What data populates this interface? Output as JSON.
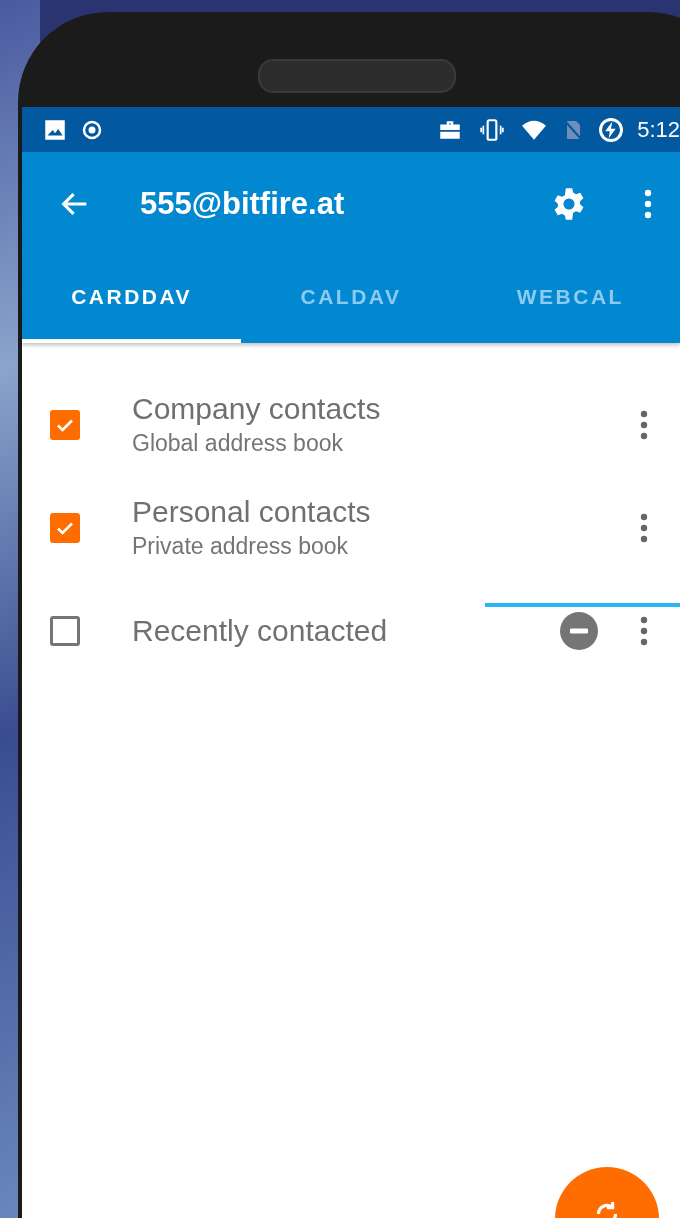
{
  "status_bar": {
    "time": "5:12"
  },
  "toolbar": {
    "title": "555@bitfire.at"
  },
  "tabs": [
    {
      "label": "CARDDAV",
      "selected": true
    },
    {
      "label": "CALDAV",
      "selected": false
    },
    {
      "label": "WEBCAL",
      "selected": false
    }
  ],
  "address_books": [
    {
      "title": "Company contacts",
      "subtitle": "Global address book",
      "checked": true,
      "read_only": false
    },
    {
      "title": "Personal contacts",
      "subtitle": "Private address book",
      "checked": true,
      "read_only": false
    },
    {
      "title": "Recently contacted",
      "checked": false,
      "read_only": true
    }
  ]
}
